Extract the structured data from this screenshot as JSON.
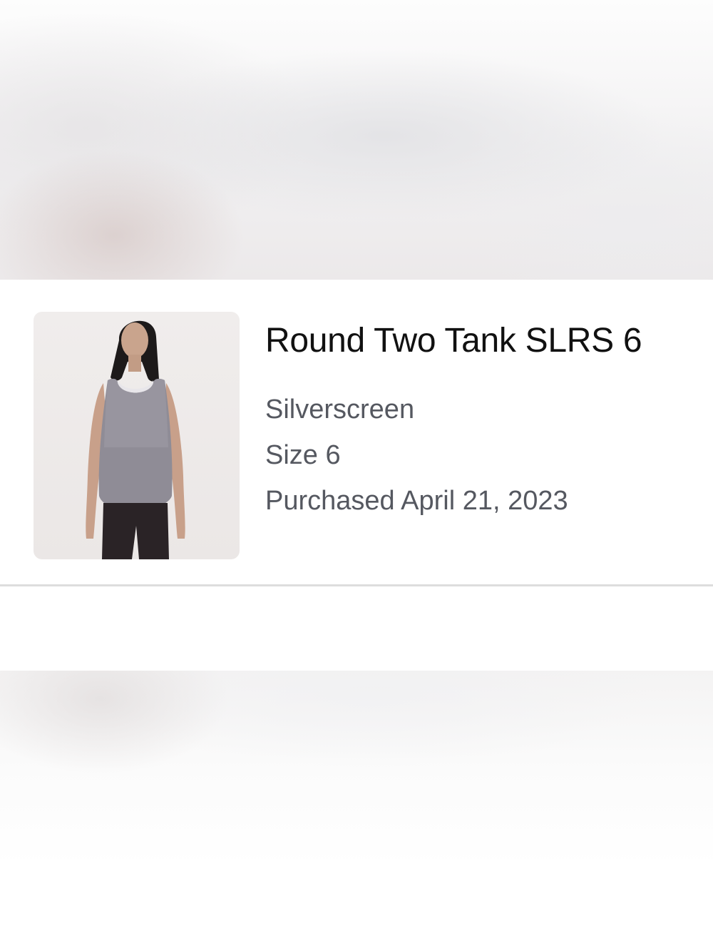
{
  "product": {
    "name": "Round Two Tank SLRS 6",
    "color": "Silverscreen",
    "size": "Size 6",
    "purchased": "Purchased April 21, 2023",
    "image_icon": "product-photo-tank-top"
  },
  "colors": {
    "title": "#111111",
    "meta": "#555860",
    "divider": "#dddddd",
    "thumb_bg": "#ece8e7"
  }
}
